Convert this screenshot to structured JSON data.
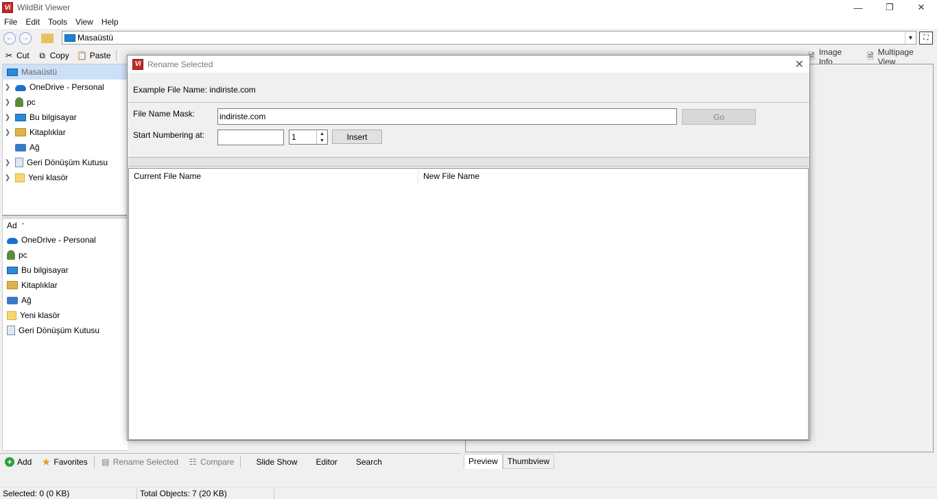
{
  "app": {
    "title": "WildBit Viewer",
    "icon_text": "Vi"
  },
  "menu": [
    "File",
    "Edit",
    "Tools",
    "View",
    "Help"
  ],
  "address": {
    "path": "Masaüstü"
  },
  "toolbar": {
    "cut": "Cut",
    "copy": "Copy",
    "paste": "Paste"
  },
  "right_toolbar": {
    "image_info": "Image Info",
    "multipage_view": "Multipage View"
  },
  "tree": {
    "items": [
      {
        "label": "Masaüstü",
        "icon": "desktop-icon",
        "selected": true
      },
      {
        "label": "OneDrive - Personal",
        "icon": "cloud-icon"
      },
      {
        "label": "pc",
        "icon": "user-icon"
      },
      {
        "label": "Bu bilgisayar",
        "icon": "computer-icon"
      },
      {
        "label": "Kitaplıklar",
        "icon": "library-icon"
      },
      {
        "label": "Ağ",
        "icon": "network-icon"
      },
      {
        "label": "Geri Dönüşüm Kutusu",
        "icon": "recycle-bin-icon"
      },
      {
        "label": "Yeni klasör",
        "icon": "folder-icon"
      }
    ]
  },
  "file_list": {
    "header": "Ad",
    "items": [
      {
        "label": "OneDrive - Personal",
        "icon": "cloud-icon"
      },
      {
        "label": "pc",
        "icon": "user-icon"
      },
      {
        "label": "Bu bilgisayar",
        "icon": "computer-icon"
      },
      {
        "label": "Kitaplıklar",
        "icon": "library-icon"
      },
      {
        "label": "Ağ",
        "icon": "network-icon"
      },
      {
        "label": "Yeni klasör",
        "icon": "folder-icon"
      },
      {
        "label": "Geri Dönüşüm Kutusu",
        "icon": "recycle-bin-icon"
      }
    ]
  },
  "bottom_toolbar": {
    "add": "Add",
    "favorites": "Favorites",
    "rename_selected": "Rename Selected",
    "compare": "Compare",
    "slide_show": "Slide Show",
    "editor": "Editor",
    "search": "Search"
  },
  "preview_tabs": {
    "preview": "Preview",
    "thumbview": "Thumbview"
  },
  "status": {
    "selected": "Selected: 0 (0 KB)",
    "total": "Total Objects: 7 (20 KB)"
  },
  "dialog": {
    "title": "Rename Selected",
    "example_label": "Example File Name:",
    "example_value": "indiriste.com",
    "mask_label": "File Name Mask:",
    "mask_value": "indiriste.com",
    "go_label": "Go",
    "numbering_label": "Start Numbering at:",
    "numbering_text": "",
    "numbering_value": "1",
    "insert_label": "Insert",
    "col_current": "Current File Name",
    "col_new": "New File Name"
  },
  "colors": {
    "accent": "#c0282d",
    "selection": "#cce0f8"
  }
}
